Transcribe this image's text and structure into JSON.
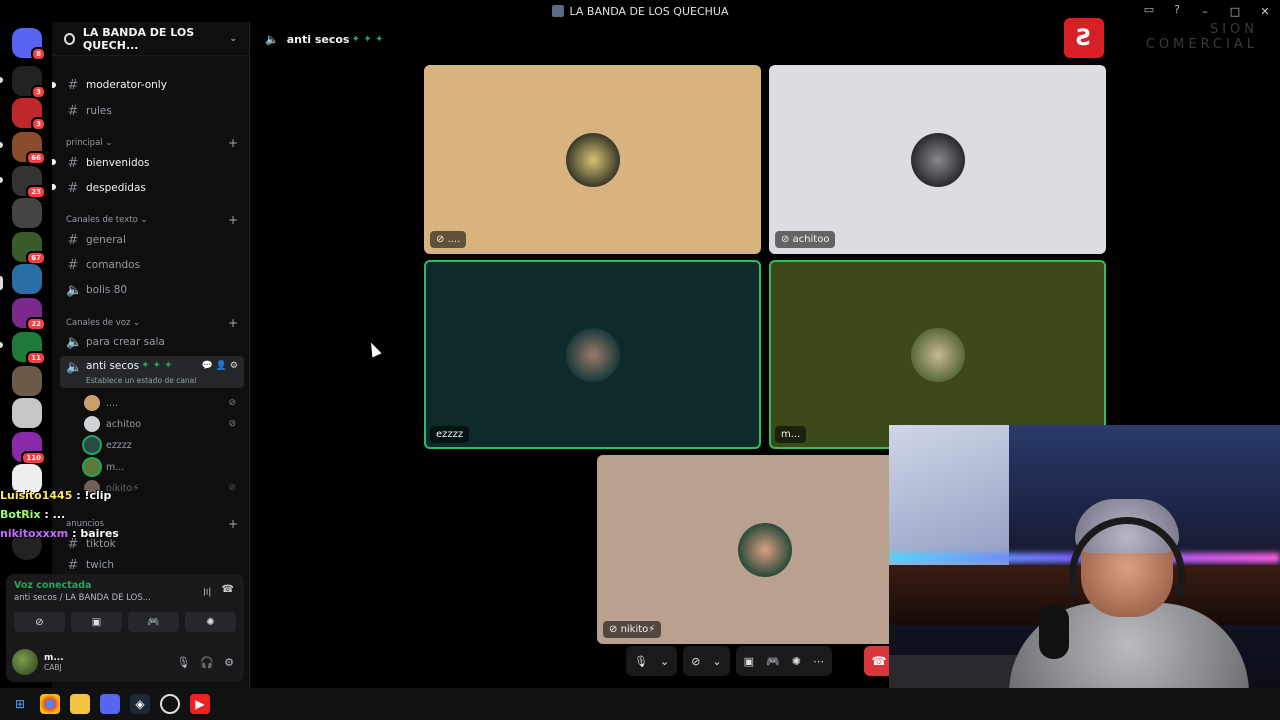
{
  "window": {
    "title": "LA BANDA DE LOS QUECHUA"
  },
  "rail": {
    "servers": [
      {
        "name": "home",
        "badge": "8",
        "color": "#5865f2"
      },
      {
        "name": "s1",
        "badge": "3",
        "color": "#222"
      },
      {
        "name": "s2",
        "badge": "3",
        "color": "#c0292b"
      },
      {
        "name": "s3",
        "badge": "66",
        "color": "#8a4b2a"
      },
      {
        "name": "s4",
        "badge": "23",
        "color": "#333"
      },
      {
        "name": "s5",
        "badge": "",
        "color": "#444"
      },
      {
        "name": "s6",
        "badge": "67",
        "color": "#3a5a2a"
      },
      {
        "name": "s7",
        "badge": "",
        "color": "#2a6ea6"
      },
      {
        "name": "s8",
        "badge": "22",
        "color": "#7a2a8a"
      },
      {
        "name": "s9",
        "badge": "11",
        "color": "#1f7a3a"
      },
      {
        "name": "s10",
        "badge": "",
        "color": "#6a5a4a"
      },
      {
        "name": "s11",
        "badge": "",
        "color": "#c7c7c7"
      },
      {
        "name": "s12",
        "badge": "110",
        "color": "#8a2aaa"
      },
      {
        "name": "s13",
        "badge": "",
        "color": "#eee"
      }
    ]
  },
  "guild": {
    "name": "LA BANDA DE LOS QUECH..."
  },
  "channels": {
    "moderator": "moderator-only",
    "rules": "rules",
    "cat_principal": "principal",
    "bienvenidos": "bienvenidos",
    "despedidas": "despedidas",
    "cat_texto": "Canales de texto",
    "general": "general",
    "comandos": "comandos",
    "bolis": "bolis 80",
    "cat_voz": "Canales de voz",
    "crear_sala": "para crear sala",
    "anti_secos": "anti secos",
    "anti_secos_status": "Establece un estado de canal",
    "cat_anuncios": "anuncios",
    "tiktok": "tiktok",
    "twich": "twich"
  },
  "voice_users": [
    {
      "name": "....",
      "color": "#c9a06a",
      "muted": true
    },
    {
      "name": "achitoo",
      "color": "#cfd2d6",
      "muted": true
    },
    {
      "name": "ezzzz",
      "color": "#2b4a48",
      "muted": false
    },
    {
      "name": "m...",
      "color": "#5b7a3a",
      "muted": false
    },
    {
      "name": "nikito⚡",
      "color": "#b19788",
      "muted": true
    }
  ],
  "chat_overlay": [
    {
      "user": "Luisito1445",
      "msg": "!clip"
    },
    {
      "user": "BotRix",
      "msg": "..."
    },
    {
      "user": "nikitoxxxm",
      "msg": "baires"
    }
  ],
  "voice_panel": {
    "status": "Voz conectada",
    "channel": "anti secos / LA BANDA DE LOS...",
    "user_name": "m...",
    "user_status": "CABJ"
  },
  "header": {
    "channel": "anti secos"
  },
  "tiles": [
    {
      "name": "....",
      "bg": "#d8b37f",
      "speaking": false,
      "av": "#3a3a2a",
      "muted": true
    },
    {
      "name": "achitoo",
      "bg": "#dcdde0",
      "speaking": false,
      "av": "#2a2a2e",
      "muted": true
    },
    {
      "name": "ezzzz",
      "bg": "#0f2a2a",
      "speaking": true,
      "av": "#3a3a3a",
      "muted": false
    },
    {
      "name": "m...",
      "bg": "#3c4a1a",
      "speaking": true,
      "av": "#8a8a6a",
      "muted": false
    },
    {
      "name": "nikito⚡",
      "bg": "#b9a08f",
      "speaking": false,
      "av": "#2a4a3a",
      "muted": true
    }
  ],
  "brand": {
    "line1": "SION",
    "line2": "COMERCIAL"
  }
}
